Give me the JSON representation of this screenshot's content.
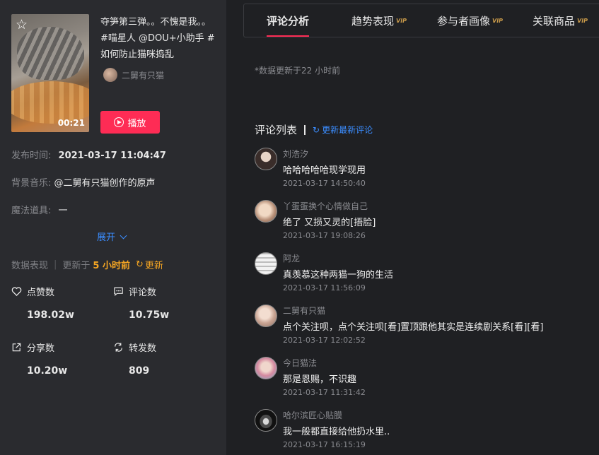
{
  "video": {
    "title": "夺笋第三弹。。不愧是我。。#喵星人 @DOU+小助手 #如何防止猫咪捣乱",
    "duration": "00:21",
    "author": "二舅有只猫",
    "play_label": "播放"
  },
  "info": {
    "publish_label": "发布时间:",
    "publish_value": "2021-03-17 11:04:47",
    "music_label": "背景音乐:",
    "music_value": "@二舅有只猫创作的原声",
    "prop_label": "魔法道具:",
    "prop_value": "一",
    "expand_label": "展开"
  },
  "data_header": {
    "label": "数据表现",
    "sep": "|",
    "updated_prefix": "更新于",
    "updated_hours": "5 小时前",
    "refresh_label": "更新"
  },
  "stats": [
    {
      "label": "点赞数",
      "value": "198.02w",
      "icon": "heart-icon"
    },
    {
      "label": "评论数",
      "value": "10.75w",
      "icon": "comment-icon"
    },
    {
      "label": "分享数",
      "value": "10.20w",
      "icon": "share-icon"
    },
    {
      "label": "转发数",
      "value": "809",
      "icon": "repost-icon"
    }
  ],
  "tabs": [
    {
      "label": "评论分析",
      "active": true,
      "vip": false
    },
    {
      "label": "趋势表现",
      "active": false,
      "vip": true
    },
    {
      "label": "参与者画像",
      "active": false,
      "vip": true
    },
    {
      "label": "关联商品",
      "active": false,
      "vip": true
    }
  ],
  "vip_badge": "VIP",
  "update_note": "*数据更新于22 小时前",
  "comment_list": {
    "title": "评论列表",
    "update_label": "更新最新评论"
  },
  "comments": [
    {
      "name": "刘浩汐",
      "text": "哈哈哈哈哈现学现用",
      "time": "2021-03-17 14:50:40"
    },
    {
      "name": "丫蛋蛋换个心情做自己",
      "text": "绝了 又损又灵的[捂脸]",
      "time": "2021-03-17 19:08:26"
    },
    {
      "name": "阿龙",
      "text": "真羡慕这种两猫一狗的生活",
      "time": "2021-03-17 11:56:09"
    },
    {
      "name": "二舅有只猫",
      "text": "点个关注呗，点个关注呗[看]置顶跟他其实是连续剧关系[看][看]",
      "time": "2021-03-17 12:02:52"
    },
    {
      "name": "今日猫法",
      "text": "那是恩赐，不识趣",
      "time": "2021-03-17 11:31:42"
    },
    {
      "name": "哈尔滨匠心贴膜",
      "text": "我一般都直接给他扔水里..",
      "time": "2021-03-17 16:15:19"
    }
  ],
  "colors": {
    "accent_red": "#fe2c55",
    "link_blue": "#3b8dff",
    "highlight_orange": "#f5a623"
  }
}
